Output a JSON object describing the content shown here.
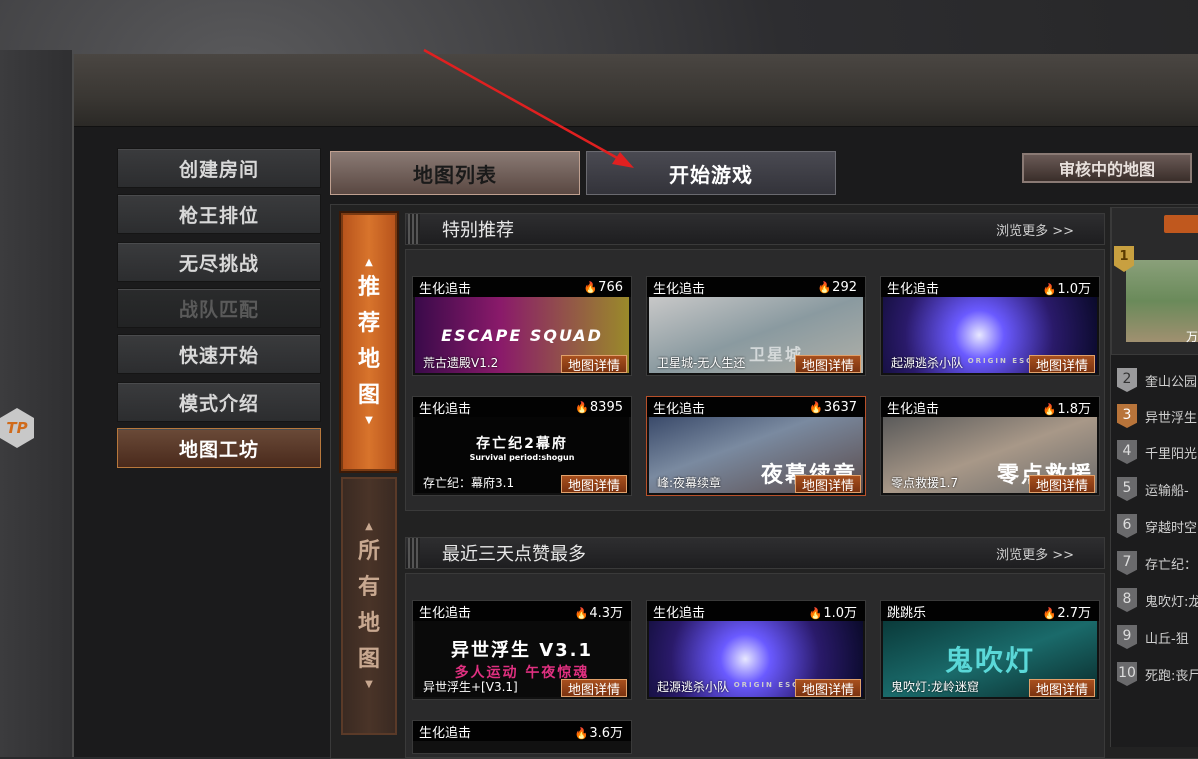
{
  "menu": {
    "items": [
      {
        "label": "创建房间",
        "state": "normal"
      },
      {
        "label": "枪王排位",
        "state": "normal"
      },
      {
        "label": "无尽挑战",
        "state": "normal"
      },
      {
        "label": "战队匹配",
        "state": "disabled"
      },
      {
        "label": "快速开始",
        "state": "normal"
      },
      {
        "label": "模式介绍",
        "state": "normal"
      },
      {
        "label": "地图工坊",
        "state": "active"
      }
    ]
  },
  "tabs": {
    "map_list": "地图列表",
    "start_game": "开始游戏",
    "reviewing": "审核中的地图"
  },
  "side_tabs": {
    "recommended": [
      "推",
      "荐",
      "地",
      "图"
    ],
    "all": [
      "所",
      "有",
      "地",
      "图"
    ]
  },
  "logo_text": "TP",
  "sections": [
    {
      "title": "特别推荐",
      "more": "浏览更多 >>",
      "cards": [
        {
          "category": "生化追击",
          "heat": "766",
          "name": "荒古遗殿V1.2",
          "thumb_text": "ESCAPE SQUAD",
          "detail": "地图详情"
        },
        {
          "category": "生化追击",
          "heat": "292",
          "name": "卫星城-无人生还",
          "thumb_text": "卫星城",
          "detail": "地图详情"
        },
        {
          "category": "生化追击",
          "heat": "1.0万",
          "name": "起源逃杀小队",
          "thumb_text": "ORIGIN ESCAPESQUAD",
          "detail": "地图详情"
        },
        {
          "category": "生化追击",
          "heat": "8395",
          "name": "存亡纪：幕府3.1",
          "thumb_text": "存亡纪2幕府",
          "thumb_sub": "Survival period:shogun",
          "detail": "地图详情"
        },
        {
          "category": "生化追击",
          "heat": "3637",
          "name": "峰:夜幕续章",
          "thumb_text": "夜幕续章",
          "detail": "地图详情"
        },
        {
          "category": "生化追击",
          "heat": "1.8万",
          "name": "零点救援1.7",
          "thumb_text": "零点救援",
          "detail": "地图详情"
        }
      ]
    },
    {
      "title": "最近三天点赞最多",
      "more": "浏览更多 >>",
      "cards": [
        {
          "category": "生化追击",
          "heat": "4.3万",
          "name": "异世浮生+[V3.1]",
          "thumb_text": "异世浮生 V3.1",
          "thumb_sub": "多人运动 午夜惊魂",
          "detail": "地图详情"
        },
        {
          "category": "生化追击",
          "heat": "1.0万",
          "name": "起源逃杀小队",
          "thumb_text": "ORIGIN ESCAPESQUAD",
          "detail": "地图详情"
        },
        {
          "category": "跳跳乐",
          "heat": "2.7万",
          "name": "鬼吹灯:龙岭迷窟",
          "thumb_text": "鬼吹灯",
          "detail": "地图详情"
        },
        {
          "category": "生化追击",
          "heat": "3.6万",
          "name": "",
          "thumb_text": "",
          "detail": ""
        }
      ]
    }
  ],
  "ranking": {
    "top_label": "万",
    "rows": [
      {
        "rank": "1",
        "name": ""
      },
      {
        "rank": "2",
        "name": "奎山公园"
      },
      {
        "rank": "3",
        "name": "异世浮生"
      },
      {
        "rank": "4",
        "name": "千里阳光"
      },
      {
        "rank": "5",
        "name": "运输船-"
      },
      {
        "rank": "6",
        "name": "穿越时空"
      },
      {
        "rank": "7",
        "name": "存亡纪："
      },
      {
        "rank": "8",
        "name": "鬼吹灯:龙"
      },
      {
        "rank": "9",
        "name": "山丘-狙"
      },
      {
        "rank": "10",
        "name": "死跑:丧尸"
      }
    ]
  },
  "colors": {
    "accent_orange": "#c0581e",
    "annotation_red": "#e02020"
  }
}
